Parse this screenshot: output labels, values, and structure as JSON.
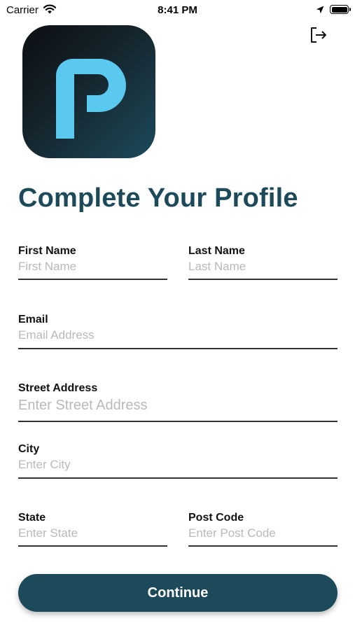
{
  "status_bar": {
    "carrier": "Carrier",
    "time": "8:41 PM",
    "icons": [
      "wifi-icon",
      "location-arrow-icon",
      "battery-icon"
    ]
  },
  "header": {
    "logout_icon": "logout-icon",
    "logo": {
      "letter": "P",
      "bg_color": "#1c4a5b",
      "letter_color": "#5bc8ef"
    }
  },
  "title": "Complete Your Profile",
  "form": {
    "first_name": {
      "label": "First Name",
      "placeholder": "First Name",
      "value": ""
    },
    "last_name": {
      "label": "Last Name",
      "placeholder": "Last Name",
      "value": ""
    },
    "email": {
      "label": "Email",
      "placeholder": "Email Address",
      "value": ""
    },
    "street": {
      "label": "Street Address",
      "placeholder": "Enter Street Address",
      "value": ""
    },
    "city": {
      "label": "City",
      "placeholder": "Enter City",
      "value": ""
    },
    "state": {
      "label": "State",
      "placeholder": "Enter State",
      "value": ""
    },
    "post_code": {
      "label": "Post Code",
      "placeholder": "Enter Post Code",
      "value": ""
    }
  },
  "continue_label": "Continue",
  "colors": {
    "accent": "#1d4a5a",
    "logo_blue": "#5bc8ef",
    "placeholder": "#b9b9bd"
  }
}
